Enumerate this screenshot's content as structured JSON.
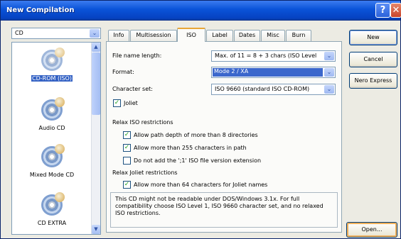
{
  "window": {
    "title": "New Compilation"
  },
  "titlebar": {
    "help_glyph": "?",
    "close_glyph": "✕"
  },
  "media_combo": {
    "value": "CD",
    "arrow_glyph": "⌄"
  },
  "compilation_types": [
    {
      "label": "CD-ROM (ISO)"
    },
    {
      "label": "Audio CD"
    },
    {
      "label": "Mixed Mode CD"
    },
    {
      "label": "CD EXTRA"
    }
  ],
  "scroll": {
    "up_glyph": "▲",
    "down_glyph": "▼"
  },
  "tabs": [
    "Info",
    "Multisession",
    "ISO",
    "Label",
    "Dates",
    "Misc",
    "Burn"
  ],
  "iso": {
    "file_name_length_label": "File name length:",
    "file_name_length_value": "Max. of 11 = 8 + 3 chars (ISO Level",
    "format_label": "Format:",
    "format_value": "Mode 2 / XA",
    "charset_label": "Character set:",
    "charset_value": "ISO 9660 (standard ISO CD-ROM)",
    "joliet_label": "Joliet",
    "joliet_checked": true,
    "relax_iso_heading": "Relax ISO restrictions",
    "relax_iso_options": [
      {
        "label": "Allow path depth of more than 8 directories",
        "checked": true
      },
      {
        "label": "Allow more than 255 characters in path",
        "checked": true
      },
      {
        "label": "Do not add the ';1' ISO file version extension",
        "checked": false
      }
    ],
    "relax_joliet_heading": "Relax Joliet restrictions",
    "relax_joliet_options": [
      {
        "label": "Allow more than 64 characters for Joliet names",
        "checked": true
      }
    ],
    "note_line1": "This CD might not be readable under DOS/Windows 3.1x. For full",
    "note_line2": "compatibility choose ISO Level 1, ISO 9660 character set, and no relaxed",
    "note_line3": "ISO restrictions."
  },
  "buttons": {
    "new": "New",
    "cancel": "Cancel",
    "nero_express": "Nero Express",
    "open": "Open..."
  },
  "colors": {
    "titlebar": "#0a53d8",
    "selection": "#3462c4",
    "checkmark": "#21a121",
    "active_tab_accent": "#e8a637"
  },
  "icons": {
    "compilation": "disc-icon",
    "check": "checkmark-icon"
  }
}
